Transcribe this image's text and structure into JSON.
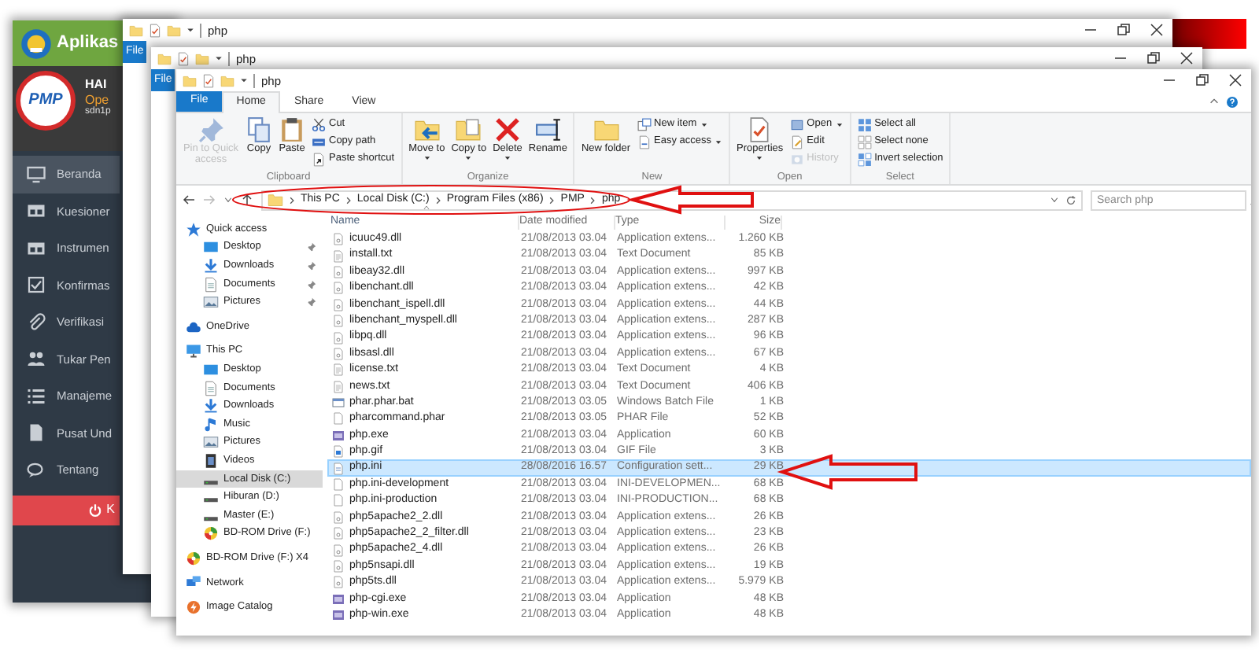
{
  "app_window": {
    "title": "Aplikas",
    "logo_text": "PMP",
    "greeting": "HAI",
    "status": "Ope",
    "user": "sdn1p",
    "menu": [
      {
        "label": "Beranda",
        "selected": true
      },
      {
        "label": "Kuesioner",
        "selected": false
      },
      {
        "label": "Instrumen",
        "selected": false
      },
      {
        "label": "Konfirmas",
        "selected": false
      },
      {
        "label": "Verifikasi",
        "selected": false
      },
      {
        "label": "Tukar Pen",
        "selected": false
      },
      {
        "label": "Manajeme",
        "selected": false
      },
      {
        "label": "Pusat Und",
        "selected": false
      },
      {
        "label": "Tentang",
        "selected": false
      }
    ],
    "logout_button": "K"
  },
  "background_windows": [
    {
      "title": "php",
      "file_tab": "File"
    },
    {
      "title": "php",
      "file_tab": "File"
    }
  ],
  "window": {
    "title": "php",
    "tabs": [
      {
        "label": "File",
        "kind": "file",
        "selected": false
      },
      {
        "label": "Home",
        "kind": "tab",
        "selected": true
      },
      {
        "label": "Share",
        "kind": "tab",
        "selected": false
      },
      {
        "label": "View",
        "kind": "tab",
        "selected": false
      }
    ],
    "ribbon": [
      {
        "group": "Clipboard",
        "items": [
          {
            "label": "Pin to Quick access",
            "kind": "large",
            "disabled": true
          },
          {
            "label": "Copy",
            "kind": "large",
            "disabled": false
          },
          {
            "label": "Paste",
            "kind": "large",
            "disabled": false
          },
          {
            "label": "Cut",
            "kind": "small",
            "disabled": false
          },
          {
            "label": "Copy path",
            "kind": "small",
            "disabled": false
          },
          {
            "label": "Paste shortcut",
            "kind": "small",
            "disabled": false
          }
        ]
      },
      {
        "group": "Organize",
        "items": [
          {
            "label": "Move to",
            "kind": "large",
            "disabled": false,
            "dropdown": true
          },
          {
            "label": "Copy to",
            "kind": "large",
            "disabled": false,
            "dropdown": true
          },
          {
            "label": "Delete",
            "kind": "large",
            "disabled": false,
            "dropdown": true
          },
          {
            "label": "Rename",
            "kind": "large",
            "disabled": false
          }
        ]
      },
      {
        "group": "New",
        "items": [
          {
            "label": "New folder",
            "kind": "large",
            "disabled": false
          },
          {
            "label": "New item",
            "kind": "small",
            "disabled": false,
            "dropdown": true
          },
          {
            "label": "Easy access",
            "kind": "small",
            "disabled": false,
            "dropdown": true
          }
        ]
      },
      {
        "group": "Open",
        "items": [
          {
            "label": "Properties",
            "kind": "large",
            "disabled": false,
            "dropdown": true
          },
          {
            "label": "Open",
            "kind": "small",
            "disabled": false,
            "dropdown": true
          },
          {
            "label": "Edit",
            "kind": "small",
            "disabled": false
          },
          {
            "label": "History",
            "kind": "small",
            "disabled": true
          }
        ]
      },
      {
        "group": "Select",
        "items": [
          {
            "label": "Select all",
            "kind": "small",
            "disabled": false
          },
          {
            "label": "Select none",
            "kind": "small",
            "disabled": false
          },
          {
            "label": "Invert selection",
            "kind": "small",
            "disabled": false
          }
        ]
      }
    ],
    "address": {
      "path": [
        "This PC",
        "Local Disk (C:)",
        "Program Files (x86)",
        "PMP",
        "php"
      ],
      "search_placeholder": "Search php"
    },
    "navigation": [
      {
        "label": "Quick access",
        "kind": "star",
        "selected": false,
        "children": [
          {
            "label": "Desktop",
            "kind": "desktop",
            "selected": false,
            "pinned": true
          },
          {
            "label": "Downloads",
            "kind": "download",
            "selected": false,
            "pinned": true
          },
          {
            "label": "Documents",
            "kind": "document",
            "selected": false,
            "pinned": true
          },
          {
            "label": "Pictures",
            "kind": "pictures",
            "selected": false,
            "pinned": true
          }
        ]
      },
      {
        "label": "OneDrive",
        "kind": "cloud",
        "selected": false
      },
      {
        "label": "This PC",
        "kind": "pc",
        "selected": false,
        "children": [
          {
            "label": "Desktop",
            "kind": "desktop",
            "selected": false
          },
          {
            "label": "Documents",
            "kind": "document",
            "selected": false
          },
          {
            "label": "Downloads",
            "kind": "download",
            "selected": false
          },
          {
            "label": "Music",
            "kind": "music",
            "selected": false
          },
          {
            "label": "Pictures",
            "kind": "pictures",
            "selected": false
          },
          {
            "label": "Videos",
            "kind": "videos",
            "selected": false
          },
          {
            "label": "Local Disk (C:)",
            "kind": "drive",
            "selected": true
          },
          {
            "label": "Hiburan (D:)",
            "kind": "drive",
            "selected": false
          },
          {
            "label": "Master (E:)",
            "kind": "drive",
            "selected": false
          },
          {
            "label": "BD-ROM Drive (F:)",
            "kind": "optical",
            "selected": false
          }
        ]
      },
      {
        "label": "BD-ROM Drive (F:) X4",
        "kind": "optical",
        "selected": false
      },
      {
        "label": "Network",
        "kind": "network",
        "selected": false
      },
      {
        "label": "Image Catalog",
        "kind": "catalog",
        "selected": false
      }
    ],
    "files": {
      "columns": [
        "Name",
        "Date modified",
        "Type",
        "Size"
      ],
      "rows": [
        {
          "name": "icuuc49.dll",
          "date": "21/08/2013 03.04",
          "type": "Application extens...",
          "size": "1.260 KB",
          "kind": "dll",
          "selected": false
        },
        {
          "name": "install.txt",
          "date": "21/08/2013 03.04",
          "type": "Text Document",
          "size": "85 KB",
          "kind": "txt",
          "selected": false
        },
        {
          "name": "libeay32.dll",
          "date": "21/08/2013 03.04",
          "type": "Application extens...",
          "size": "997 KB",
          "kind": "dll",
          "selected": false
        },
        {
          "name": "libenchant.dll",
          "date": "21/08/2013 03.04",
          "type": "Application extens...",
          "size": "42 KB",
          "kind": "dll",
          "selected": false
        },
        {
          "name": "libenchant_ispell.dll",
          "date": "21/08/2013 03.04",
          "type": "Application extens...",
          "size": "44 KB",
          "kind": "dll",
          "selected": false
        },
        {
          "name": "libenchant_myspell.dll",
          "date": "21/08/2013 03.04",
          "type": "Application extens...",
          "size": "287 KB",
          "kind": "dll",
          "selected": false
        },
        {
          "name": "libpq.dll",
          "date": "21/08/2013 03.04",
          "type": "Application extens...",
          "size": "96 KB",
          "kind": "dll",
          "selected": false
        },
        {
          "name": "libsasl.dll",
          "date": "21/08/2013 03.04",
          "type": "Application extens...",
          "size": "67 KB",
          "kind": "dll",
          "selected": false
        },
        {
          "name": "license.txt",
          "date": "21/08/2013 03.04",
          "type": "Text Document",
          "size": "4 KB",
          "kind": "txt",
          "selected": false
        },
        {
          "name": "news.txt",
          "date": "21/08/2013 03.04",
          "type": "Text Document",
          "size": "406 KB",
          "kind": "txt",
          "selected": false
        },
        {
          "name": "phar.phar.bat",
          "date": "21/08/2013 03.05",
          "type": "Windows Batch File",
          "size": "1 KB",
          "kind": "bat",
          "selected": false
        },
        {
          "name": "pharcommand.phar",
          "date": "21/08/2013 03.05",
          "type": "PHAR File",
          "size": "52 KB",
          "kind": "file",
          "selected": false
        },
        {
          "name": "php.exe",
          "date": "21/08/2013 03.04",
          "type": "Application",
          "size": "60 KB",
          "kind": "exe",
          "selected": false
        },
        {
          "name": "php.gif",
          "date": "21/08/2013 03.04",
          "type": "GIF File",
          "size": "3 KB",
          "kind": "gif",
          "selected": false
        },
        {
          "name": "php.ini",
          "date": "28/08/2016 16.57",
          "type": "Configuration sett...",
          "size": "29 KB",
          "kind": "ini",
          "selected": true
        },
        {
          "name": "php.ini-development",
          "date": "21/08/2013 03.04",
          "type": "INI-DEVELOPMEN...",
          "size": "68 KB",
          "kind": "file",
          "selected": false
        },
        {
          "name": "php.ini-production",
          "date": "21/08/2013 03.04",
          "type": "INI-PRODUCTION...",
          "size": "68 KB",
          "kind": "file",
          "selected": false
        },
        {
          "name": "php5apache2_2.dll",
          "date": "21/08/2013 03.04",
          "type": "Application extens...",
          "size": "26 KB",
          "kind": "dll",
          "selected": false
        },
        {
          "name": "php5apache2_2_filter.dll",
          "date": "21/08/2013 03.04",
          "type": "Application extens...",
          "size": "23 KB",
          "kind": "dll",
          "selected": false
        },
        {
          "name": "php5apache2_4.dll",
          "date": "21/08/2013 03.04",
          "type": "Application extens...",
          "size": "26 KB",
          "kind": "dll",
          "selected": false
        },
        {
          "name": "php5nsapi.dll",
          "date": "21/08/2013 03.04",
          "type": "Application extens...",
          "size": "19 KB",
          "kind": "dll",
          "selected": false
        },
        {
          "name": "php5ts.dll",
          "date": "21/08/2013 03.04",
          "type": "Application extens...",
          "size": "5.979 KB",
          "kind": "dll",
          "selected": false
        },
        {
          "name": "php-cgi.exe",
          "date": "21/08/2013 03.04",
          "type": "Application",
          "size": "48 KB",
          "kind": "exe",
          "selected": false
        },
        {
          "name": "php-win.exe",
          "date": "21/08/2013 03.04",
          "type": "Application",
          "size": "48 KB",
          "kind": "exe",
          "selected": false
        }
      ]
    }
  }
}
